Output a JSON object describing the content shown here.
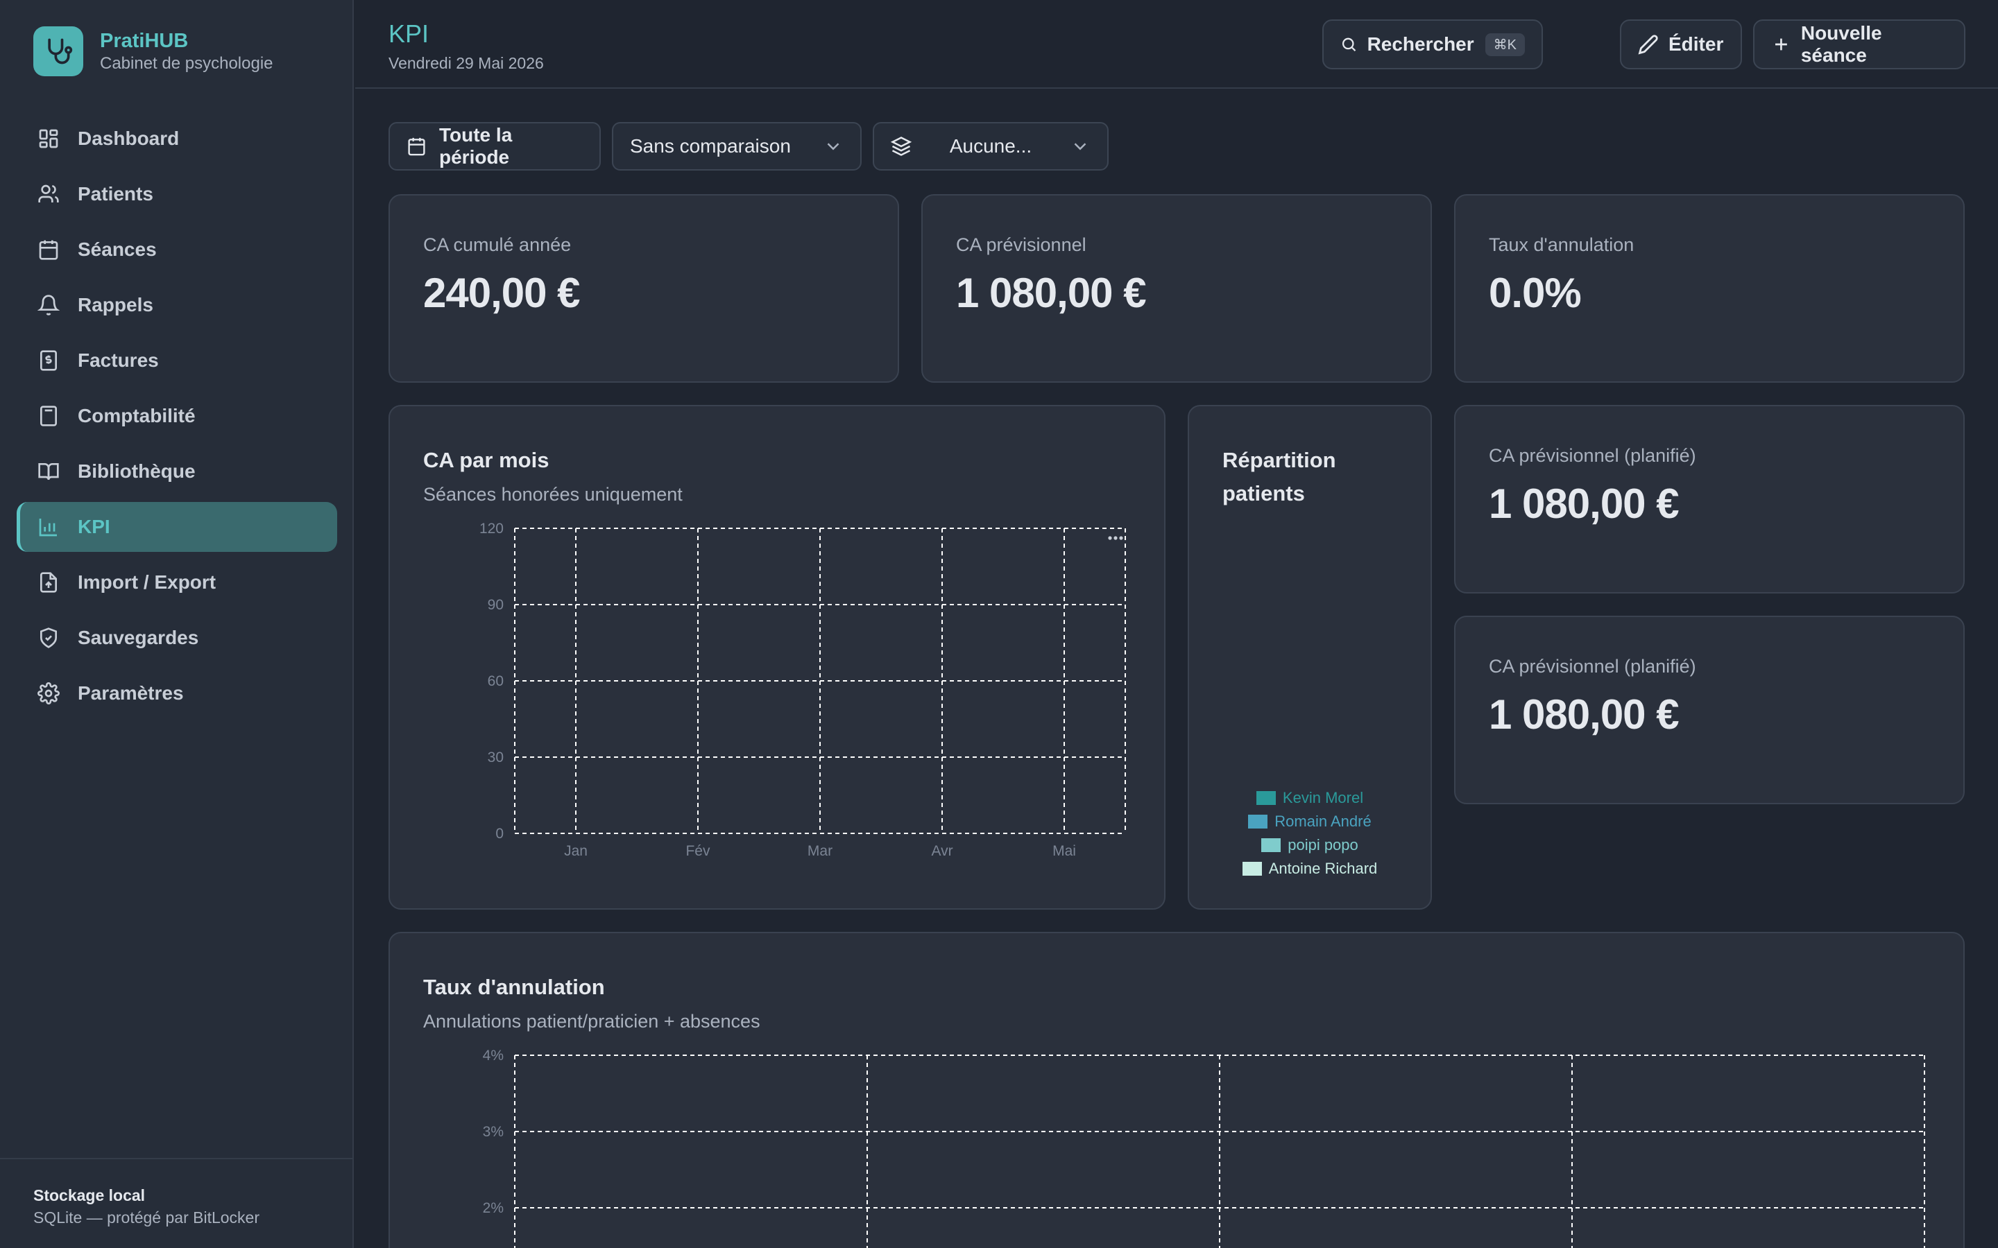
{
  "brand": {
    "name": "PratiHUB",
    "subtitle": "Cabinet de psychologie"
  },
  "sidebar": {
    "items": [
      {
        "label": "Dashboard",
        "icon": "grid-icon"
      },
      {
        "label": "Patients",
        "icon": "users-icon"
      },
      {
        "label": "Séances",
        "icon": "calendar-icon"
      },
      {
        "label": "Rappels",
        "icon": "bell-icon"
      },
      {
        "label": "Factures",
        "icon": "receipt-icon"
      },
      {
        "label": "Comptabilité",
        "icon": "calculator-icon"
      },
      {
        "label": "Bibliothèque",
        "icon": "book-icon"
      },
      {
        "label": "KPI",
        "icon": "bar-chart-icon",
        "active": true
      },
      {
        "label": "Import / Export",
        "icon": "file-import-icon"
      },
      {
        "label": "Sauvegardes",
        "icon": "shield-icon"
      },
      {
        "label": "Paramètres",
        "icon": "gear-icon"
      }
    ],
    "footer": {
      "title": "Stockage local",
      "subtitle": "SQLite — protégé par BitLocker"
    }
  },
  "header": {
    "title": "KPI",
    "date": "Vendredi 29 Mai 2026",
    "search_label": "Rechercher",
    "search_shortcut": "⌘K",
    "edit_label": "Éditer",
    "new_session_label": "Nouvelle séance"
  },
  "filters": {
    "period": "Toute la période",
    "comparison": "Sans comparaison",
    "layer": "Aucune..."
  },
  "kpis": {
    "ca_cumule": {
      "label": "CA cumulé année",
      "value": "240,00 €"
    },
    "ca_previsionnel": {
      "label": "CA prévisionnel",
      "value": "1 080,00 €"
    },
    "taux_annulation": {
      "label": "Taux d'annulation",
      "value": "0.0%"
    },
    "ca_planifie_1": {
      "label": "CA prévisionnel (planifié)",
      "value": "1 080,00 €"
    },
    "ca_planifie_2": {
      "label": "CA prévisionnel (planifié)",
      "value": "1 080,00 €"
    }
  },
  "ca_chart": {
    "title": "CA par mois",
    "subtitle": "Séances honorées uniquement"
  },
  "repartition": {
    "title_line1": "Répartition",
    "title_line2": "patients",
    "legend": [
      {
        "name": "Kevin Morel",
        "color": "#2a9a9a"
      },
      {
        "name": "Romain André",
        "color": "#4aa3c0"
      },
      {
        "name": "poipi popo",
        "color": "#7fcccc"
      },
      {
        "name": "Antoine Richard",
        "color": "#c8ece4"
      }
    ]
  },
  "annulation_chart": {
    "title": "Taux d'annulation",
    "subtitle": "Annulations patient/praticien + absences"
  },
  "colors": {
    "accent": "#5cc5c5",
    "background": "#1f2530",
    "card": "#2a303c"
  },
  "chart_data": [
    {
      "type": "bar",
      "title": "CA par mois",
      "subtitle": "Séances honorées uniquement",
      "categories": [
        "Jan",
        "Fév",
        "Mar",
        "Avr",
        "Mai"
      ],
      "values": [
        null,
        null,
        null,
        null,
        null
      ],
      "yticks": [
        "0",
        "30",
        "60",
        "90",
        "120"
      ],
      "ylim": [
        0,
        120
      ],
      "grid": true
    },
    {
      "type": "pie",
      "title": "Répartition patients",
      "categories": [
        "Kevin Morel",
        "Romain André",
        "poipi popo",
        "Antoine Richard"
      ],
      "legend": "bottom"
    },
    {
      "type": "line",
      "title": "Taux d'annulation",
      "subtitle": "Annulations patient/praticien + absences",
      "yticks": [
        "2%",
        "3%",
        "4%"
      ],
      "grid": true
    }
  ]
}
